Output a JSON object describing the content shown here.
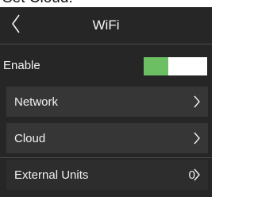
{
  "caption": "Set Cloud:",
  "header": {
    "title": "WiFi",
    "back_icon": "chevron-left-icon"
  },
  "enable": {
    "label": "Enable",
    "state": "on",
    "on_color": "#6cc063"
  },
  "menu": {
    "network": {
      "label": "Network",
      "icon": "chevron-right-icon"
    },
    "cloud": {
      "label": "Cloud",
      "icon": "chevron-right-icon"
    },
    "external_units": {
      "label": "External Units",
      "count": "0",
      "icon": "chevron-right-icon"
    }
  },
  "colors": {
    "background": "#262626",
    "item_background": "#363636",
    "text": "#f2f2f2"
  }
}
